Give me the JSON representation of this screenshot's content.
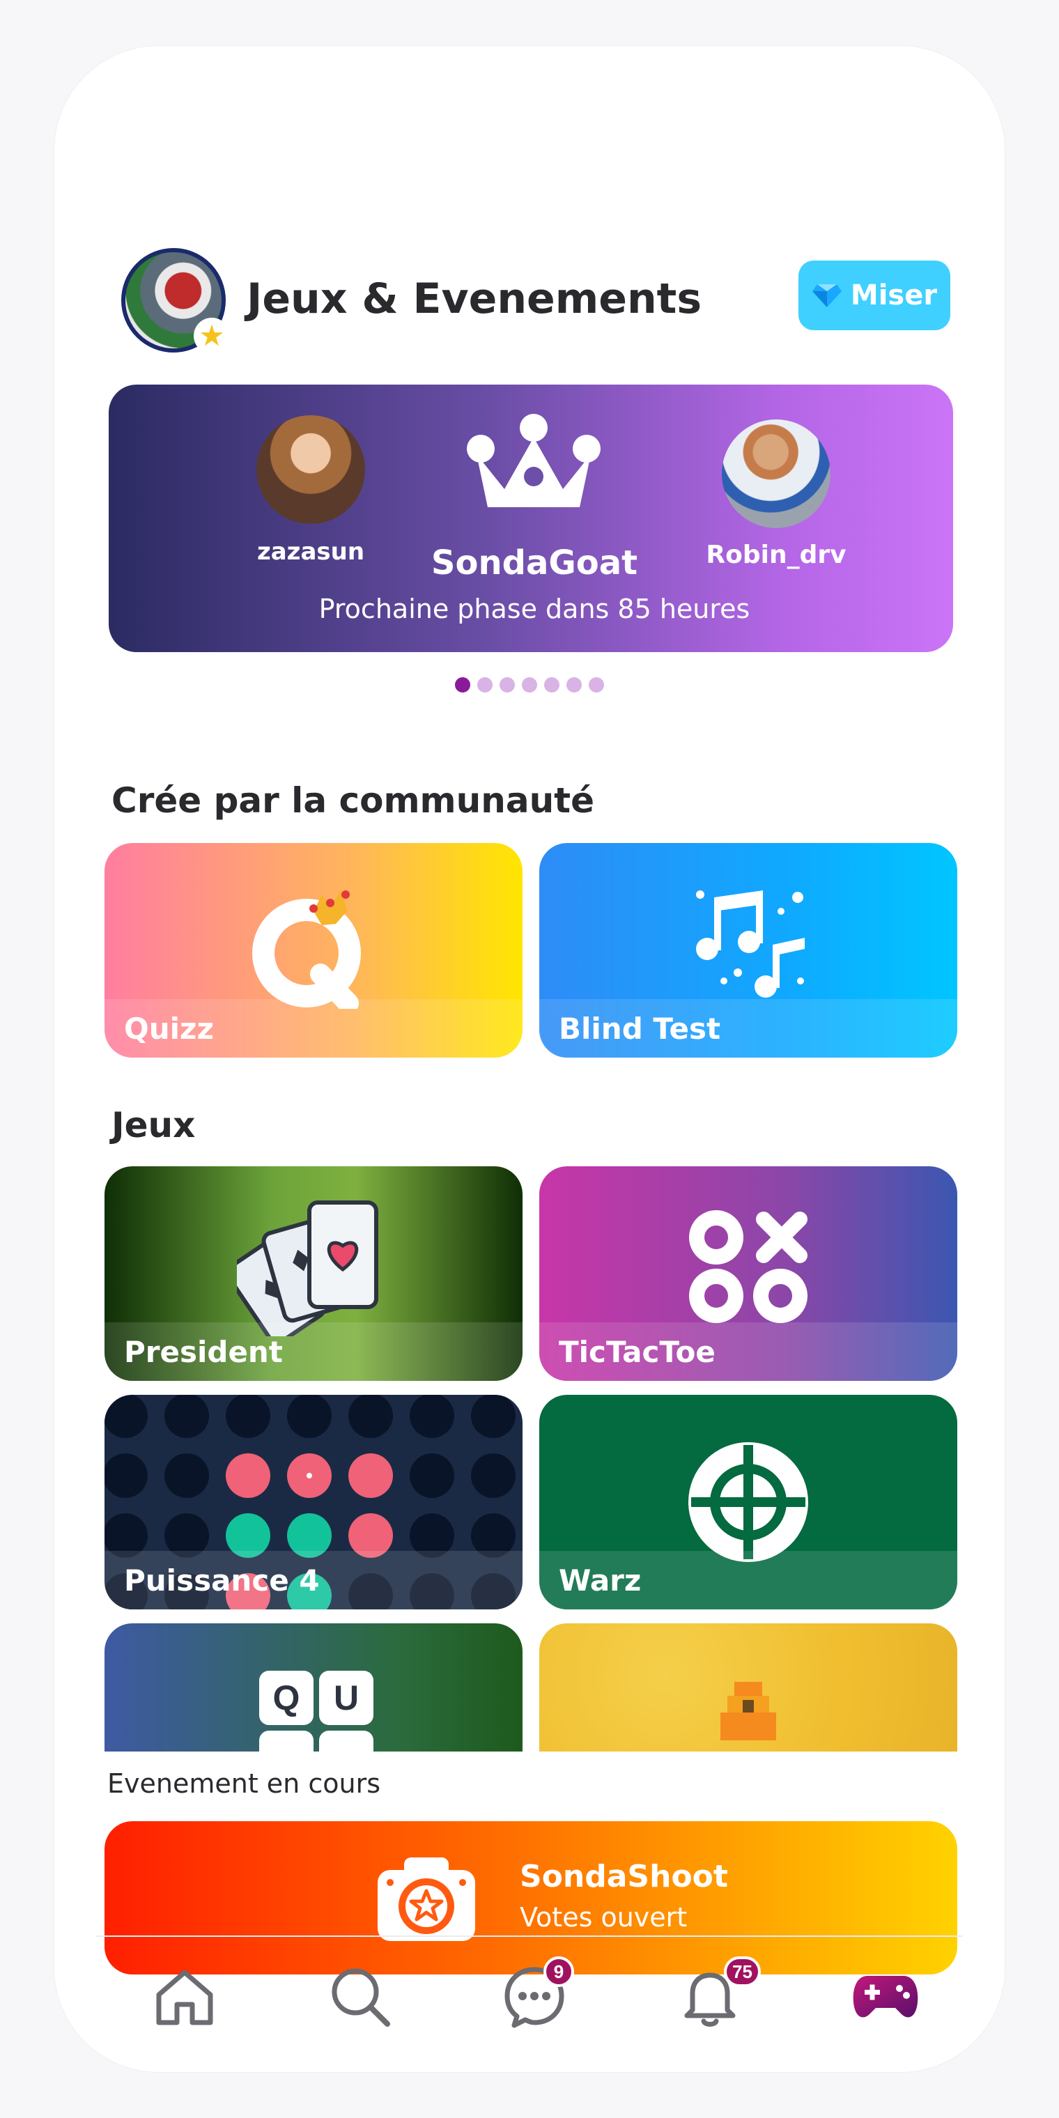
{
  "header": {
    "title": "Jeux & Evenements",
    "miser_label": "Miser"
  },
  "banner": {
    "left_user": "zazasun",
    "right_user": "Robin_drv",
    "title": "SondaGoat",
    "subtitle": "Prochaine phase dans 85 heures",
    "page_count": 7,
    "active_page": 1
  },
  "community": {
    "title": "Crée par la communauté",
    "tiles": [
      {
        "label": "Quizz"
      },
      {
        "label": "Blind Test"
      }
    ]
  },
  "games": {
    "title": "Jeux",
    "tiles": [
      {
        "label": "President"
      },
      {
        "label": "TicTacToe"
      },
      {
        "label": "Puissance 4"
      },
      {
        "label": "Warz"
      }
    ],
    "partial_letters": [
      "Q",
      "U"
    ]
  },
  "event": {
    "section_label": "Evenement en cours",
    "name": "SondaShoot",
    "status": "Votes ouvert"
  },
  "nav": {
    "messages_badge": "9",
    "notifications_badge": "75",
    "items": [
      "home-icon",
      "search-icon",
      "chat-icon",
      "bell-icon",
      "gamepad-icon"
    ]
  },
  "colors": {
    "accent_purple": "#8b1a9a",
    "badge": "#a0125f",
    "miser": "#3fd0ff"
  }
}
